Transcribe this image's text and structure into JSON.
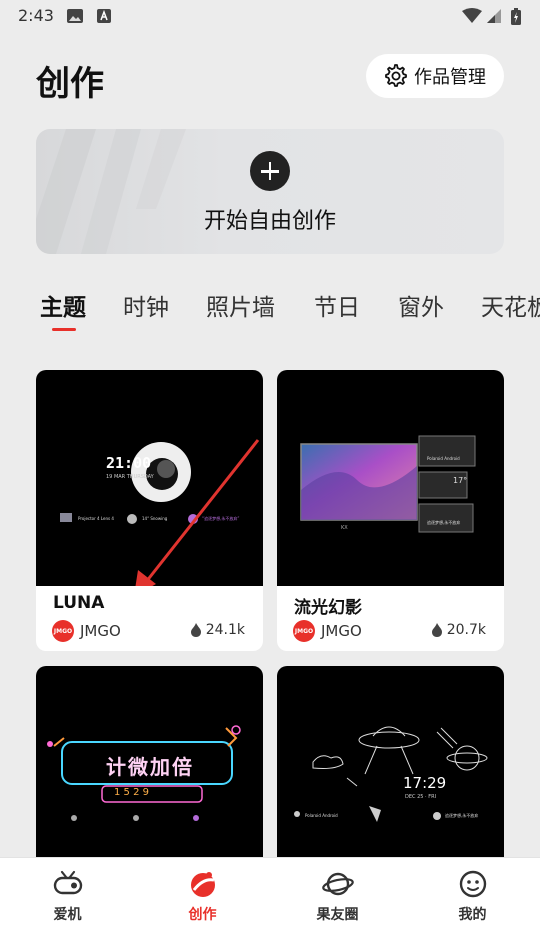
{
  "status_bar": {
    "time": "2:43"
  },
  "header": {
    "title": "创作",
    "manage_button": "作品管理"
  },
  "banner": {
    "label": "开始自由创作"
  },
  "tabs": [
    {
      "label": "主题",
      "active": true
    },
    {
      "label": "时钟",
      "active": false
    },
    {
      "label": "照片墙",
      "active": false
    },
    {
      "label": "节日",
      "active": false
    },
    {
      "label": "窗外",
      "active": false
    },
    {
      "label": "天花板",
      "active": false
    }
  ],
  "cards": [
    {
      "name": "LUNA",
      "author": "JMGO",
      "likes": "24.1k",
      "preview": {
        "clock": "21:00",
        "subtitle": "19 MAR THURSDAY",
        "widget1": "Projector 4 Lens 4",
        "widget2": "14° Snowing",
        "widget3": "“追逐梦想,永不放弃”"
      }
    },
    {
      "name": "流光幻影",
      "author": "JMGO",
      "likes": "20.7k",
      "preview": {
        "widget1": "Polaroid Android",
        "widget2": "17°",
        "widget3": "追逐梦想,永不放弃",
        "label": "KX"
      }
    },
    {
      "name": "",
      "author": "",
      "likes": "",
      "preview": {
        "neon_text": "计微加倍",
        "digits": "1 5 2 9"
      }
    },
    {
      "name": "",
      "author": "",
      "likes": "",
      "preview": {
        "clock": "17:29",
        "date": "DEC 25 · FRI",
        "widget1": "Polaroid Android",
        "widget2": "追逐梦想,永不放弃"
      }
    }
  ],
  "logo_text": "JMGO",
  "bottom_nav": [
    {
      "label": "爱机",
      "icon": "projector-icon",
      "active": false
    },
    {
      "label": "创作",
      "icon": "create-icon",
      "active": true
    },
    {
      "label": "果友圈",
      "icon": "planet-icon",
      "active": false
    },
    {
      "label": "我的",
      "icon": "smiley-icon",
      "active": false
    }
  ],
  "colors": {
    "accent": "#e8302a",
    "background": "#ececec"
  }
}
